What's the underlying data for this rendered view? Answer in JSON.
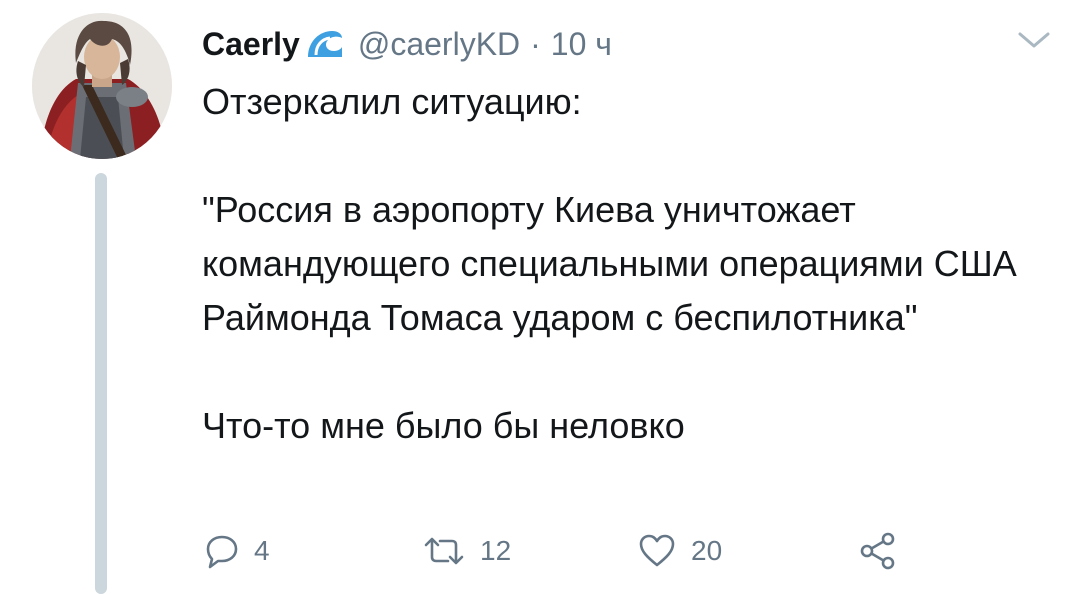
{
  "tweet": {
    "display_name": "Caerly",
    "handle": "@caerlyKD",
    "separator": "·",
    "time": "10 ч",
    "text": "Отзеркалил ситуацию:\n\n\"Россия в аэропорту Киева уничтожает командующего специальными операциями США Раймонда Томаса ударом с беспилотника\"\n\nЧто-то мне было бы неловко"
  },
  "actions": {
    "reply_count": "4",
    "retweet_count": "12",
    "like_count": "20"
  },
  "icons": {
    "badge": "wave-emoji-icon",
    "caret": "chevron-down-icon",
    "reply": "reply-icon",
    "retweet": "retweet-icon",
    "like": "heart-icon",
    "share": "share-icon"
  },
  "colors": {
    "text": "#14171a",
    "secondary": "#657786",
    "thread_line": "#ccd6dd",
    "wave": "#3ea0e0"
  }
}
